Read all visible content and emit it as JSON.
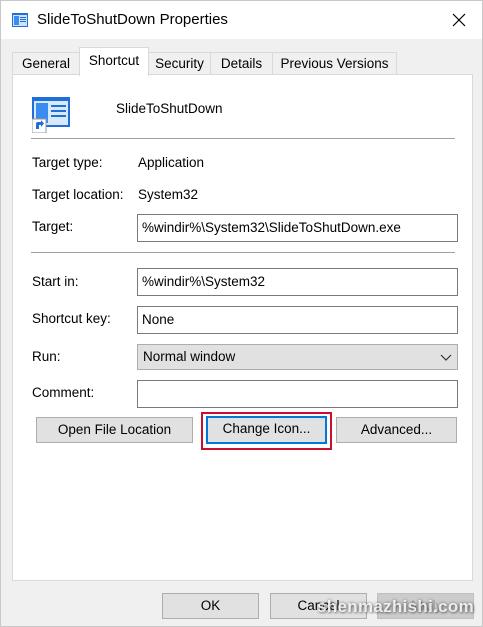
{
  "window": {
    "title": "SlideToShutDown Properties"
  },
  "tabs": [
    {
      "label": "General"
    },
    {
      "label": "Shortcut"
    },
    {
      "label": "Security"
    },
    {
      "label": "Details"
    },
    {
      "label": "Previous Versions"
    }
  ],
  "shortcut": {
    "name": "SlideToShutDown",
    "target_type_label": "Target type:",
    "target_type_value": "Application",
    "target_location_label": "Target location:",
    "target_location_value": "System32",
    "target_label": "Target:",
    "target_value": "%windir%\\System32\\SlideToShutDown.exe",
    "start_in_label": "Start in:",
    "start_in_value": "%windir%\\System32",
    "shortcut_key_label": "Shortcut key:",
    "shortcut_key_value": "None",
    "run_label": "Run:",
    "run_value": "Normal window",
    "comment_label": "Comment:",
    "comment_value": ""
  },
  "buttons": {
    "open_file_location": "Open File Location",
    "change_icon": "Change Icon...",
    "advanced": "Advanced..."
  },
  "footer": {
    "ok": "OK",
    "cancel": "Cancel",
    "apply": "Apply"
  },
  "watermark": "shenmazhishi.com",
  "colors": {
    "focus_border": "#0078d7",
    "highlight": "#c8102e"
  }
}
